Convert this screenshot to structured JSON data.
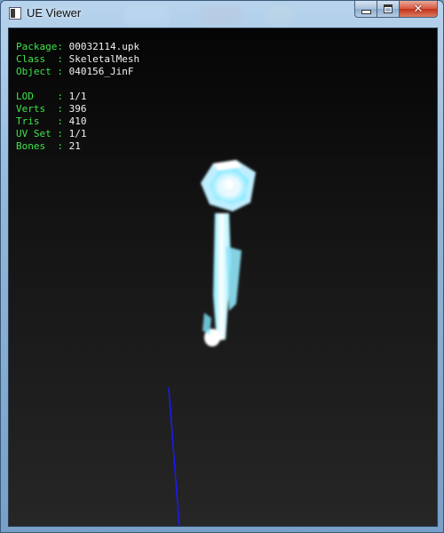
{
  "window": {
    "title": "UE Viewer"
  },
  "caption_buttons": {
    "close_glyph": "✕"
  },
  "info": {
    "package": {
      "key": "Package: ",
      "value": "00032114.upk"
    },
    "class": {
      "key": "Class  : ",
      "value": "SkeletalMesh"
    },
    "object": {
      "key": "Object : ",
      "value": "040156_JinF"
    },
    "lod": {
      "key": "LOD    : ",
      "value": "1/1"
    },
    "verts": {
      "key": "Verts  : ",
      "value": "396"
    },
    "tris": {
      "key": "Tris   : ",
      "value": "410"
    },
    "uvset": {
      "key": "UV Set : ",
      "value": "1/1"
    },
    "bones": {
      "key": "Bones  : ",
      "value": "21"
    }
  },
  "colors": {
    "label_green": "#3ee64a",
    "value_white": "#f2f2f2",
    "axis_blue": "#1a1aff",
    "mesh_cyan": "#7fe9ff"
  }
}
